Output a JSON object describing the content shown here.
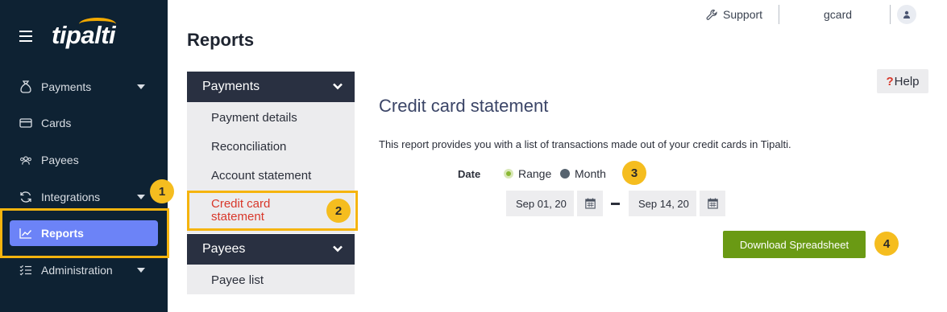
{
  "sidebar": {
    "logo": "tipalti",
    "items": [
      {
        "label": "Payments",
        "icon": "money-bag-icon",
        "has_caret": true
      },
      {
        "label": "Cards",
        "icon": "card-icon",
        "has_caret": false
      },
      {
        "label": "Payees",
        "icon": "people-icon",
        "has_caret": false
      },
      {
        "label": "Integrations",
        "icon": "sync-icon",
        "has_caret": true
      },
      {
        "label": "Reports",
        "icon": "chart-icon",
        "has_caret": false,
        "active": true
      },
      {
        "label": "Administration",
        "icon": "checklist-icon",
        "has_caret": true
      }
    ]
  },
  "topbar": {
    "support_label": "Support",
    "username": "gcard"
  },
  "page_title": "Reports",
  "report_menu": {
    "sections": [
      {
        "label": "Payments",
        "items": [
          "Payment details",
          "Reconciliation",
          "Account statement",
          "Credit card statement"
        ]
      },
      {
        "label": "Payees",
        "items": [
          "Payee list"
        ]
      }
    ],
    "selected_item": "Credit card statement",
    "selected_line1": "Credit card",
    "selected_line2": "statement"
  },
  "report": {
    "help_label": "Help",
    "title": "Credit card statement",
    "description": "This report provides you with a list of transactions made out of your credit cards in Tipalti.",
    "date_label": "Date",
    "radio_range": "Range",
    "radio_month": "Month",
    "selected_mode": "Range",
    "start_date": "Sep 01, 20",
    "end_date": "Sep 14, 20",
    "download_label": "Download Spreadsheet"
  },
  "callouts": [
    "1",
    "2",
    "3",
    "4"
  ],
  "colors": {
    "sidebar_bg": "#0e2233",
    "active_nav": "#6c83f7",
    "callout": "#f5bd1f",
    "download_btn": "#6a9a14",
    "selected_report": "#d8372a"
  }
}
